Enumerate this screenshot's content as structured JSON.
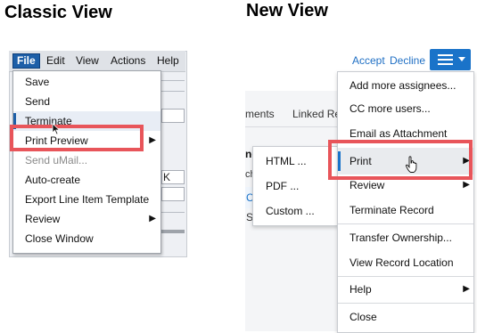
{
  "headings": {
    "classic": "Classic View",
    "new": "New View"
  },
  "classic": {
    "menubar": [
      "File",
      "Edit",
      "View",
      "Actions",
      "Help"
    ],
    "menu_items": [
      {
        "label": "Save",
        "disabled": false,
        "submenu": false
      },
      {
        "label": "Send",
        "disabled": false,
        "submenu": false
      },
      {
        "label": "Terminate",
        "disabled": false,
        "submenu": false
      },
      {
        "label": "Print Preview",
        "disabled": false,
        "submenu": true
      },
      {
        "label": "Send uMail...",
        "disabled": true,
        "submenu": false
      },
      {
        "label": "Auto-create",
        "disabled": false,
        "submenu": false
      },
      {
        "label": "Export Line Item Template",
        "disabled": false,
        "submenu": false
      },
      {
        "label": "Review",
        "disabled": false,
        "submenu": true
      },
      {
        "label": "Close Window",
        "disabled": false,
        "submenu": false
      }
    ],
    "background_fragment": "K",
    "highlighted_item": "Print Preview"
  },
  "new": {
    "header_links": {
      "accept": "Accept",
      "decline": "Decline"
    },
    "tabs": [
      "ments",
      "Linked Re"
    ],
    "background_fragments": [
      "ne",
      "ch",
      "C",
      "S"
    ],
    "menu_items": [
      {
        "label": "Add more assignees...",
        "submenu": false
      },
      {
        "label": "CC more users...",
        "submenu": false
      },
      {
        "label": "Email as Attachment",
        "submenu": false
      },
      {
        "label": "Print",
        "submenu": true,
        "active": true
      },
      {
        "label": "Review",
        "submenu": true
      },
      {
        "label": "Terminate Record",
        "submenu": false
      },
      {
        "label": "Transfer Ownership...",
        "submenu": false
      },
      {
        "label": "View Record Location",
        "submenu": false
      },
      {
        "label": "Help",
        "submenu": true
      },
      {
        "label": "Close",
        "submenu": false
      }
    ],
    "print_submenu": [
      "HTML ...",
      "PDF ...",
      "Custom ..."
    ],
    "highlighted_item": "Print"
  },
  "icons": {
    "menu_button": "hamburger-menu-icon",
    "dropdown": "caret-down-icon",
    "submenu": "triangle-right-icon",
    "cursor_classic": "arrow-cursor-icon",
    "cursor_new": "hand-pointer-cursor-icon"
  },
  "colors": {
    "accent_blue": "#1a73c9",
    "classic_file_blue": "#1d5fa8",
    "highlight_red": "#e8555a",
    "disabled_text": "#8a8a8a"
  }
}
